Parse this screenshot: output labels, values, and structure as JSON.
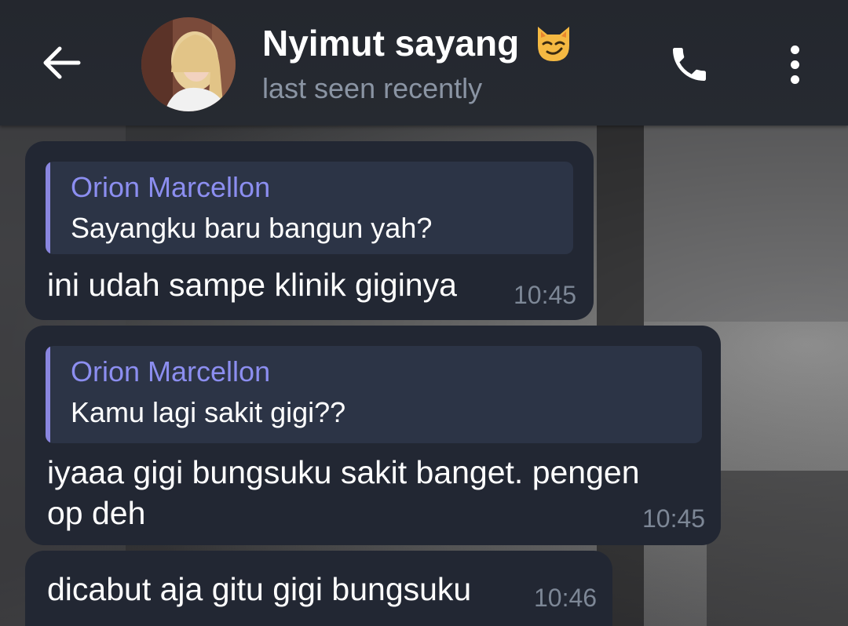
{
  "header": {
    "back_icon": "arrow-left-icon",
    "contact_name": "Nyimut sayang",
    "name_emoji": "smirking-cat-emoji",
    "status": "last seen recently",
    "call_icon": "phone-icon",
    "more_icon": "more-vertical-icon"
  },
  "messages": [
    {
      "reply_author": "Orion Marcellon",
      "reply_text": "Sayangku baru bangun yah?",
      "text_line1": "ini udah sampe klinik giginya",
      "time": "10:45"
    },
    {
      "reply_author": "Orion Marcellon",
      "reply_text": "Kamu lagi sakit gigi??",
      "text_line1": "iyaaa gigi bungsuku sakit banget. pengen",
      "text_line2": "op deh",
      "time": "10:45"
    },
    {
      "text_line1": "dicabut aja gitu gigi bungsuku",
      "time": "10:46"
    }
  ],
  "colors": {
    "header_bg": "#24272e",
    "bubble_bg": "#222733",
    "reply_bg": "#2c3446",
    "reply_accent": "#8a86e0",
    "status_text": "#8a94a3",
    "time_text": "#7d8796"
  }
}
